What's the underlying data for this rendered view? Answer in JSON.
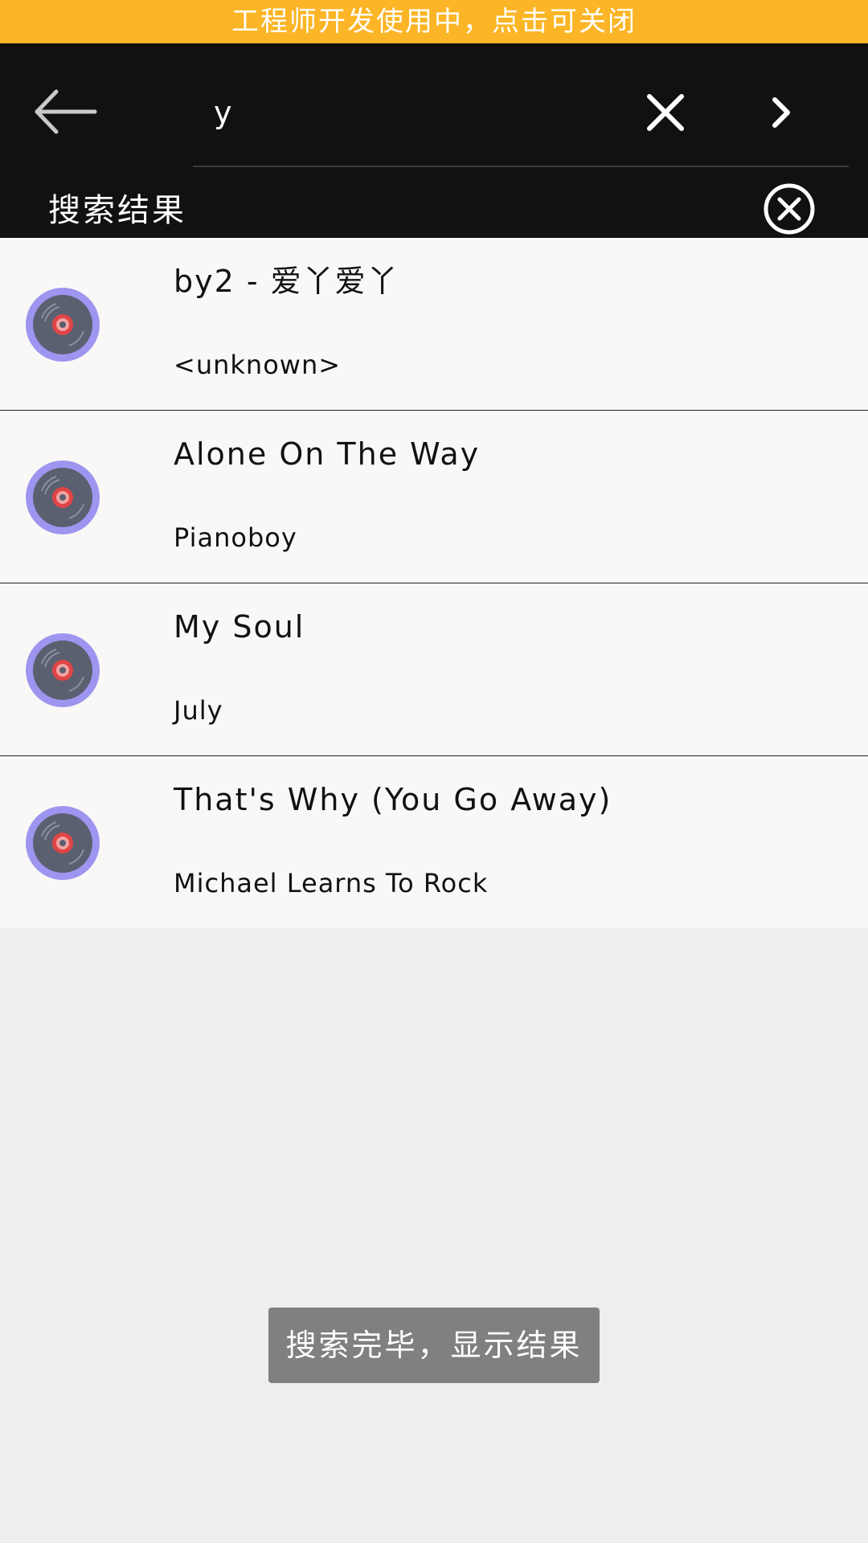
{
  "dev_banner": {
    "text": "工程师开发使用中，点击可关闭",
    "color": "#fbb526"
  },
  "search": {
    "value": "y",
    "back_icon": "arrow-left-icon",
    "clear_icon": "close-icon",
    "submit_icon": "chevron-right-icon"
  },
  "results_header": {
    "title": "搜索结果",
    "close_icon": "circle-close-icon"
  },
  "results": [
    {
      "title": "by2 - 爱丫爱丫",
      "artist": "<unknown>",
      "icon": "vinyl-disc-icon"
    },
    {
      "title": "Alone On The Way",
      "artist": "Pianoboy",
      "icon": "vinyl-disc-icon"
    },
    {
      "title": "My Soul",
      "artist": "July",
      "icon": "vinyl-disc-icon"
    },
    {
      "title": "That's Why (You Go Away)",
      "artist": "Michael Learns To Rock",
      "icon": "vinyl-disc-icon"
    }
  ],
  "toast": {
    "text": "搜索完毕，显示结果"
  },
  "colors": {
    "topbar": "#111111",
    "list_background": "#f9f8f7",
    "page_background": "#eeeeee",
    "disc_outer": "#9e95f0",
    "disc_center": "#e04545"
  }
}
